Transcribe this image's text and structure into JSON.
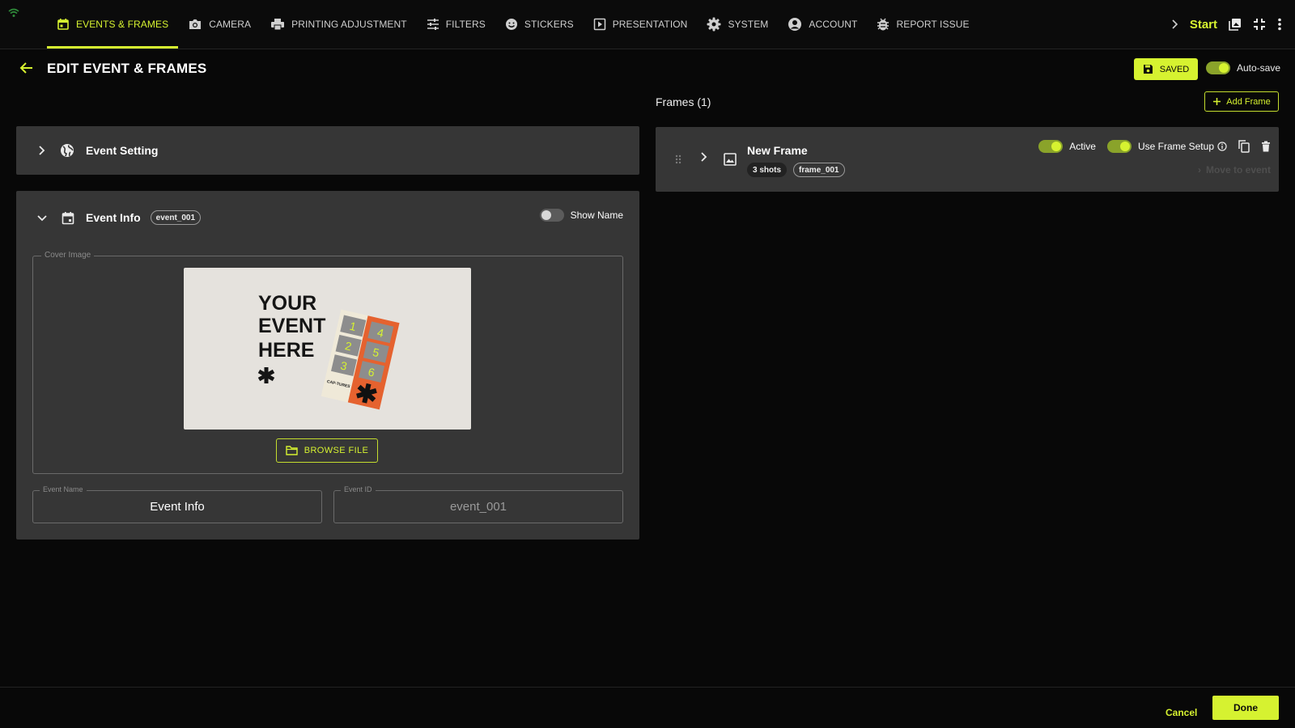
{
  "nav": {
    "tabs": [
      {
        "label": "EVENTS & FRAMES",
        "icon": "calendar-icon",
        "active": true
      },
      {
        "label": "CAMERA",
        "icon": "camera-icon"
      },
      {
        "label": "PRINTING ADJUSTMENT",
        "icon": "printer-icon"
      },
      {
        "label": "FILTERS",
        "icon": "sliders-icon"
      },
      {
        "label": "STICKERS",
        "icon": "smiley-icon"
      },
      {
        "label": "PRESENTATION",
        "icon": "play-icon"
      },
      {
        "label": "SYSTEM",
        "icon": "gear-icon"
      },
      {
        "label": "ACCOUNT",
        "icon": "account-icon"
      },
      {
        "label": "REPORT ISSUE",
        "icon": "bug-icon"
      }
    ],
    "start_label": "Start"
  },
  "header": {
    "title": "EDIT EVENT & FRAMES",
    "saved_label": "SAVED",
    "autosave_label": "Auto-save",
    "autosave_on": true
  },
  "event_setting": {
    "label": "Event Setting"
  },
  "event_info": {
    "label": "Event Info",
    "id_chip": "event_001",
    "show_name_label": "Show Name",
    "show_name_on": false,
    "cover_image_label": "Cover Image",
    "cover_text": [
      "YOUR",
      "EVENT",
      "HERE"
    ],
    "strip_numbers": [
      "1",
      "2",
      "3",
      "4",
      "5",
      "6"
    ],
    "strip_brand": "CAP-TURES",
    "browse_label": "BROWSE FILE",
    "event_name_label": "Event Name",
    "event_name_value": "Event Info",
    "event_id_label": "Event ID",
    "event_id_value": "event_001"
  },
  "frames": {
    "title": "Frames (1)",
    "add_label": "Add Frame",
    "items": [
      {
        "name": "New Frame",
        "shots": "3 shots",
        "id": "frame_001",
        "active_label": "Active",
        "active_on": true,
        "use_setup_label": "Use Frame Setup",
        "use_setup_on": true,
        "move_label": "Move to event"
      }
    ]
  },
  "footer": {
    "cancel_label": "Cancel",
    "done_label": "Done"
  },
  "colors": {
    "accent": "#d6f230",
    "panel": "#363636",
    "background": "#080808"
  }
}
